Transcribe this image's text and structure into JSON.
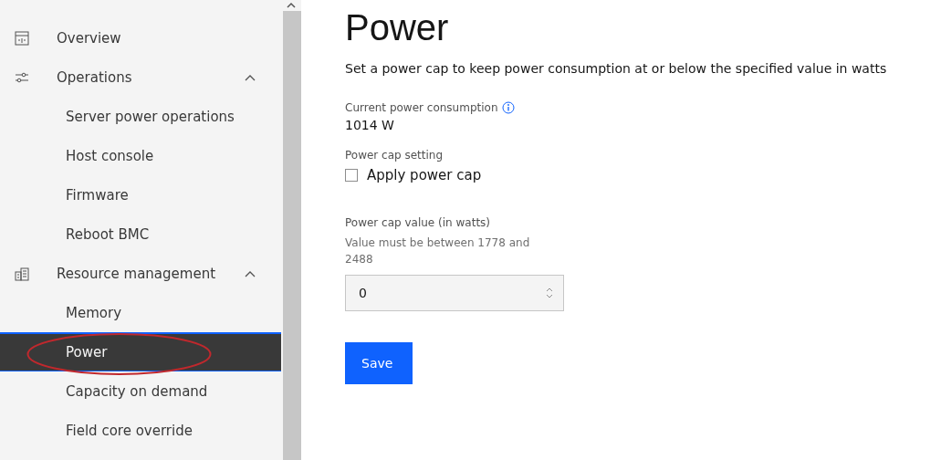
{
  "sidebar": {
    "items": [
      {
        "label": "Overview",
        "selected": false
      },
      {
        "label": "Operations",
        "expanded": true,
        "selected": false,
        "children": [
          {
            "label": "Server power operations",
            "selected": false
          },
          {
            "label": "Host console",
            "selected": false
          },
          {
            "label": "Firmware",
            "selected": false
          },
          {
            "label": "Reboot BMC",
            "selected": false
          }
        ]
      },
      {
        "label": "Resource management",
        "expanded": true,
        "selected": false,
        "children": [
          {
            "label": "Memory",
            "selected": false
          },
          {
            "label": "Power",
            "selected": true
          },
          {
            "label": "Capacity on demand",
            "selected": false
          },
          {
            "label": "Field core override",
            "selected": false
          }
        ]
      }
    ]
  },
  "page": {
    "title": "Power",
    "description": "Set a power cap to keep power consumption at or below the specified value in watts",
    "current_label": "Current power consumption",
    "current_value": "1014 W",
    "cap_setting_label": "Power cap setting",
    "apply_checkbox": {
      "label": "Apply power cap",
      "checked": false
    },
    "cap_value_label": "Power cap value (in watts)",
    "cap_value_hint": "Value must be between 1778 and 2488",
    "cap_value": "0",
    "save_button": "Save"
  }
}
